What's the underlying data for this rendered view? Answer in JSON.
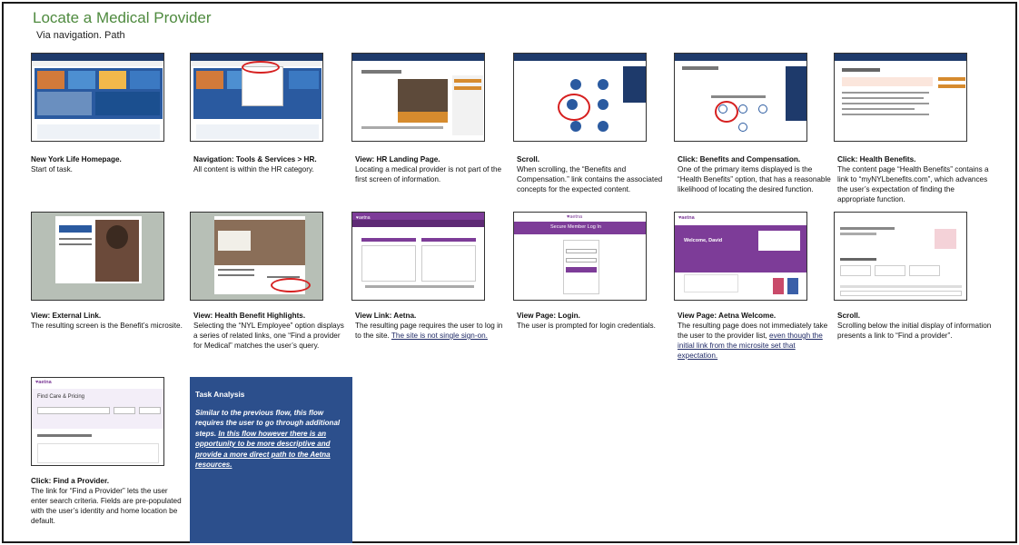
{
  "header": {
    "title": "Locate a Medical Provider",
    "subtitle": "Via navigation. Path"
  },
  "steps": [
    {
      "heading": "New York Life Homepage.",
      "body": "Start of task."
    },
    {
      "heading": "Navigation: Tools & Services > HR.",
      "body": "All content is within the HR category."
    },
    {
      "heading": "View: HR Landing Page.",
      "body": "Locating a medical provider is not part of the first screen of information."
    },
    {
      "heading": "Scroll.",
      "body": "When scrolling, the “Benefits and Compensation.” link contains the associated concepts for the expected content."
    },
    {
      "heading": "Click: Benefits and Compensation.",
      "body": "One of the primary items displayed is the “Health Benefits” option, that has a reasonable likelihood of locating the desired function."
    },
    {
      "heading": "Click: Health Benefits.",
      "body": "The content page “Health Benefits” contains a link to “myNYLbenefits.com”, which advances the user’s expectation of finding the appropriate function."
    },
    {
      "heading": "View: External Link.",
      "body": "The resulting screen is the Benefit’s microsite."
    },
    {
      "heading": "View: Health Benefit Highlights.",
      "body": "Selecting the “NYL Employee” option displays a series of related links, one “Find a provider for Medical” matches the user’s query."
    },
    {
      "heading": "View Link: Aetna.",
      "body": "The resulting page requires the user to log in to the site.",
      "underlined": "The site is not single sign-on."
    },
    {
      "heading": "View Page: Login.",
      "body": "The user is prompted for login credentials."
    },
    {
      "heading": "View Page: Aetna Welcome.",
      "body": "The resulting page does not immediately take the user to the provider list,",
      "underlined": "even though the initial link from the microsite set that expectation."
    },
    {
      "heading": "Scroll.",
      "body": "Scrolling below the initial display of information presents a link to “Find a provider”."
    },
    {
      "heading": "Click: Find a Provider.",
      "body": "The link for “Find a Provider” lets the user enter search criteria. Fields are pre-populated with the user’s identity and home location be default."
    }
  ],
  "task_analysis": {
    "title": "Task Analysis",
    "body": "Similar to the previous flow, this flow requires the user to go through additional steps.",
    "underlined": "In this flow however there is an opportunity to be more descriptive and provide a more direct path to the Aetna resources."
  },
  "colors": {
    "title_green": "#4e8a3e",
    "panel_blue": "#2c4f8c",
    "aetna_purple": "#7d3c98",
    "nyl_navy": "#1e3a6b",
    "highlight_red": "#d62020"
  },
  "thumb_text": {
    "aetna": "♥aetna",
    "welcome": "Welcome, David",
    "find_care": "Find Care & Pricing",
    "login": "Secure Member Log In"
  }
}
